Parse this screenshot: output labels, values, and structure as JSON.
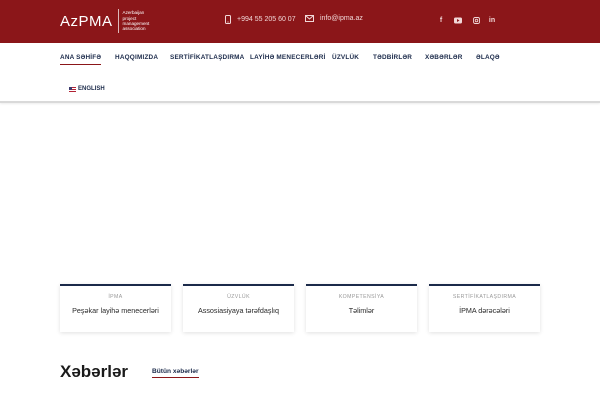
{
  "header": {
    "logo_text": "AzPMA",
    "logo_subtitle": [
      "Azerbaijan",
      "project",
      "management",
      "association"
    ],
    "phone": "+994 55 205 60 07",
    "email": "info@ipma.az",
    "social_icons": [
      "facebook-icon",
      "youtube-icon",
      "instagram-icon",
      "linkedin-icon"
    ],
    "brand_color": "#8b1619"
  },
  "nav": {
    "items": [
      {
        "label": "ANA SƏHİFƏ",
        "active": true
      },
      {
        "label": "HAQQIMIZDA"
      },
      {
        "label": "SERTİFİKATLAŞDIRMA"
      },
      {
        "label": "LAYİHƏ MENECERLƏRİ"
      },
      {
        "label": "ÜZVLÜK"
      },
      {
        "label": "TƏDBİRLƏR"
      },
      {
        "label": "XƏBƏRLƏR"
      },
      {
        "label": "ƏLAQƏ"
      }
    ],
    "language": "ENGLISH"
  },
  "cards": [
    {
      "category": "İPMA",
      "title": "Peşəkar layihə menecerləri"
    },
    {
      "category": "ÜZVLÜK",
      "title": "Assosiasiyaya tərəfdaşlıq"
    },
    {
      "category": "KOMPETENSİYA",
      "title": "Təlimlər"
    },
    {
      "category": "SERTİFİKATLAŞDIRMA",
      "title": "İPMA dərəcələri"
    }
  ],
  "news": {
    "heading": "Xəbərlər",
    "all_link": "Bütün xəbərlər"
  }
}
